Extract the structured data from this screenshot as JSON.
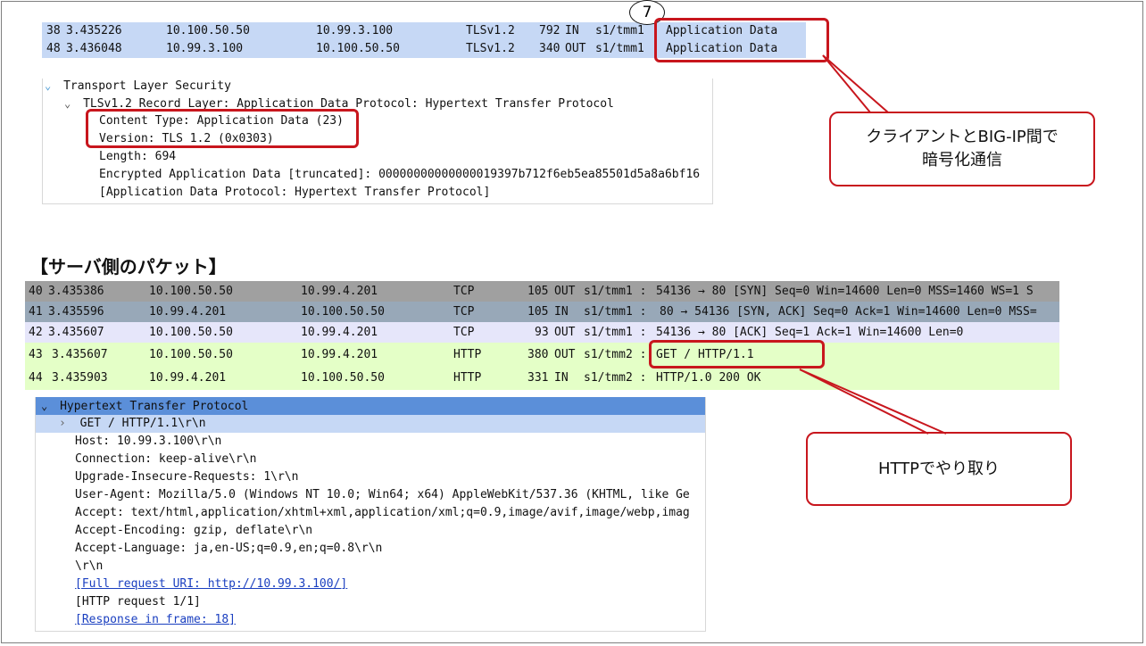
{
  "client_packets": [
    {
      "no": "38",
      "time": "3.435226",
      "src": "10.100.50.50",
      "dst": "10.99.3.100",
      "proto": "TLSv1.2",
      "len": "792",
      "dir": "IN",
      "iface": "s1/tmm1",
      "info": "Application Data"
    },
    {
      "no": "48",
      "time": "3.436048",
      "src": "10.99.3.100",
      "dst": "10.100.50.50",
      "proto": "TLSv1.2",
      "len": "340",
      "dir": "OUT",
      "iface": "s1/tmm1",
      "info": "Application Data"
    }
  ],
  "step_badge": "7",
  "tls_details": [
    "Transport Layer Security",
    "TLSv1.2 Record Layer: Application Data Protocol: Hypertext Transfer Protocol",
    "Content Type: Application Data (23)",
    "Version: TLS 1.2 (0x0303)",
    "Length: 694",
    "Encrypted Application Data [truncated]: 00000000000000019397b712f6eb5ea85501d5a8a6bf16",
    "[Application Data Protocol: Hypertext Transfer Protocol]"
  ],
  "callout_client": [
    "クライアントとBIG-IP間で",
    "暗号化通信"
  ],
  "server_heading": "【サーバ側のパケット】",
  "server_packets": [
    {
      "no": "40",
      "time": "3.435386",
      "src": "10.100.50.50",
      "dst": "10.99.4.201",
      "proto": "TCP",
      "len": "105",
      "dir": "OUT",
      "iface": "s1/tmm1 :",
      "info": "54136 → 80  [SYN] Seq=0 Win=14600 Len=0 MSS=1460 WS=1 S"
    },
    {
      "no": "41",
      "time": "3.435596",
      "src": "10.99.4.201",
      "dst": "10.100.50.50",
      "proto": "TCP",
      "len": "105",
      "dir": "IN",
      "iface": "s1/tmm1 :",
      "info": "80  → 54136 [SYN, ACK] Seq=0 Ack=1 Win=14600 Len=0 MSS="
    },
    {
      "no": "42",
      "time": "3.435607",
      "src": "10.100.50.50",
      "dst": "10.99.4.201",
      "proto": "TCP",
      "len": "93",
      "dir": "OUT",
      "iface": "s1/tmm1 :",
      "info": "54136 → 80  [ACK] Seq=1 Ack=1 Win=14600 Len=0"
    },
    {
      "no": "43",
      "time": "3.435607",
      "src": "10.100.50.50",
      "dst": "10.99.4.201",
      "proto": "HTTP",
      "len": "380",
      "dir": "OUT",
      "iface": "s1/tmm2 :",
      "info": "GET / HTTP/1.1"
    },
    {
      "no": "44",
      "time": "3.435903",
      "src": "10.99.4.201",
      "dst": "10.100.50.50",
      "proto": "HTTP",
      "len": "331",
      "dir": "IN",
      "iface": "s1/tmm2 :",
      "info": "HTTP/1.0 200 OK"
    }
  ],
  "http_details": {
    "header": "Hypertext Transfer Protocol",
    "request_line": "GET / HTTP/1.1\\r\\n",
    "lines": [
      "Host: 10.99.3.100\\r\\n",
      "Connection: keep-alive\\r\\n",
      "Upgrade-Insecure-Requests: 1\\r\\n",
      "User-Agent: Mozilla/5.0 (Windows NT 10.0; Win64; x64) AppleWebKit/537.36 (KHTML, like Ge",
      "Accept: text/html,application/xhtml+xml,application/xml;q=0.9,image/avif,image/webp,imag",
      "Accept-Encoding: gzip, deflate\\r\\n",
      "Accept-Language: ja,en-US;q=0.9,en;q=0.8\\r\\n",
      "\\r\\n"
    ],
    "full_uri": "[Full request URI: http://10.99.3.100/]",
    "request_count": "[HTTP request 1/1]",
    "response_frame": "[Response in frame: 18]"
  },
  "callout_server": "HTTPでやり取り",
  "colors": {
    "accent_red": "#c8161d",
    "row_blue": "#c6d8f5",
    "row_gray": "#a0a0a0",
    "row_steel": "#98a8b8",
    "row_lavender": "#e6e6fa",
    "row_green": "#e4ffc7",
    "header_blue": "#5b8fd9"
  }
}
